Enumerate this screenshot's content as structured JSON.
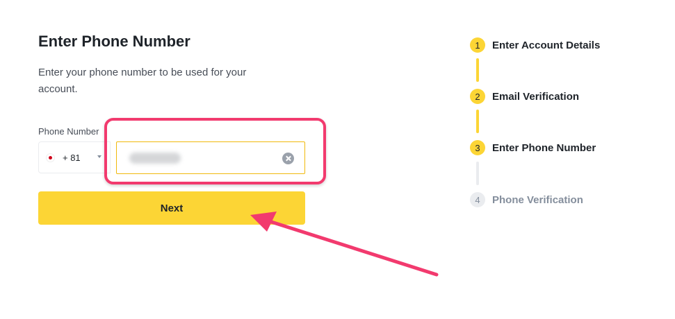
{
  "form": {
    "title": "Enter Phone Number",
    "subtitle": "Enter your phone number to be used for your account.",
    "phone_label": "Phone Number",
    "country": {
      "dial_code": "+ 81",
      "flag": "japan-flag-icon"
    },
    "phone_value": "",
    "next_label": "Next"
  },
  "steps": [
    {
      "number": "1",
      "label": "Enter Account Details",
      "state": "completed"
    },
    {
      "number": "2",
      "label": "Email Verification",
      "state": "completed"
    },
    {
      "number": "3",
      "label": "Enter Phone Number",
      "state": "current"
    },
    {
      "number": "4",
      "label": "Phone Verification",
      "state": "upcoming"
    }
  ],
  "colors": {
    "accent": "#fcd535",
    "annotation": "#f23a6e",
    "inactive": "#848e9c"
  }
}
